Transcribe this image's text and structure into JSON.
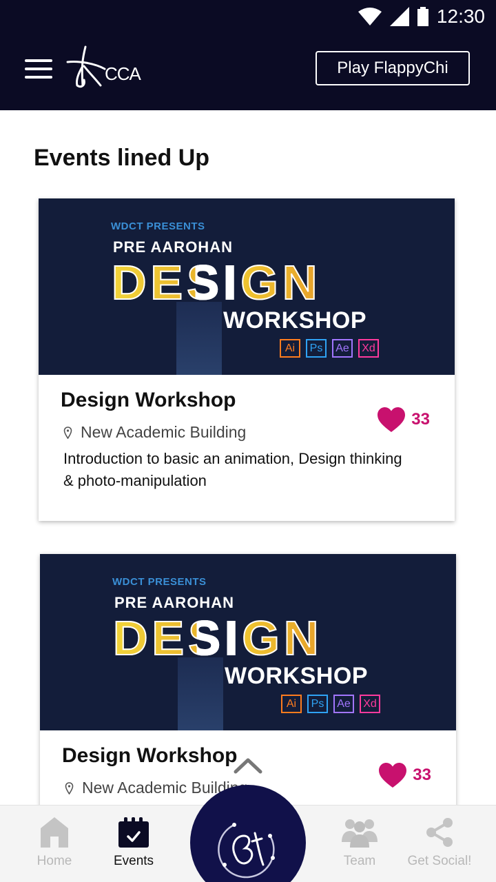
{
  "status_bar": {
    "time": "12:30",
    "icons": [
      "wifi-icon",
      "cell-signal-icon",
      "battery-icon"
    ]
  },
  "app_bar": {
    "logo_text": "CCA",
    "play_button_label": "Play FlappyChi",
    "menu_icon": "hamburger-menu-icon"
  },
  "main": {
    "section_title": "Events lined Up",
    "events": [
      {
        "banner": {
          "presents": "WDCT PRESENTS",
          "pre": "PRE AAROHAN",
          "design": "DESIGN",
          "workshop": "WORKSHOP",
          "apps": [
            "Ai",
            "Ps",
            "Ae",
            "Xd"
          ]
        },
        "title": "Design Workshop",
        "location": "New Academic Building",
        "description": "Introduction to basic an animation, Design thinking & photo-manipulation",
        "likes": "33"
      },
      {
        "banner": {
          "presents": "WDCT PRESENTS",
          "pre": "PRE AAROHAN",
          "design": "DESIGN",
          "workshop": "WORKSHOP",
          "apps": [
            "Ai",
            "Ps",
            "Ae",
            "Xd"
          ]
        },
        "title": "Design Workshop",
        "location": "New Academic Building",
        "likes": "33"
      }
    ]
  },
  "bottom_nav": {
    "items": [
      {
        "label": "Home",
        "icon": "home-icon"
      },
      {
        "label": "Events",
        "icon": "calendar-icon",
        "active": true
      },
      {
        "label": "Team",
        "icon": "team-icon"
      },
      {
        "label": "Get Social!",
        "icon": "share-icon"
      }
    ],
    "center_icon": "aarohan-logo-icon"
  },
  "colors": {
    "primary_dark": "#0b0b24",
    "fab": "#11114a",
    "like": "#c8116e",
    "banner_bg": "#131d3a",
    "ai": "#ff7c1e",
    "ps": "#2fa3f5",
    "ae": "#a276ff",
    "xd": "#ff3a9d"
  }
}
